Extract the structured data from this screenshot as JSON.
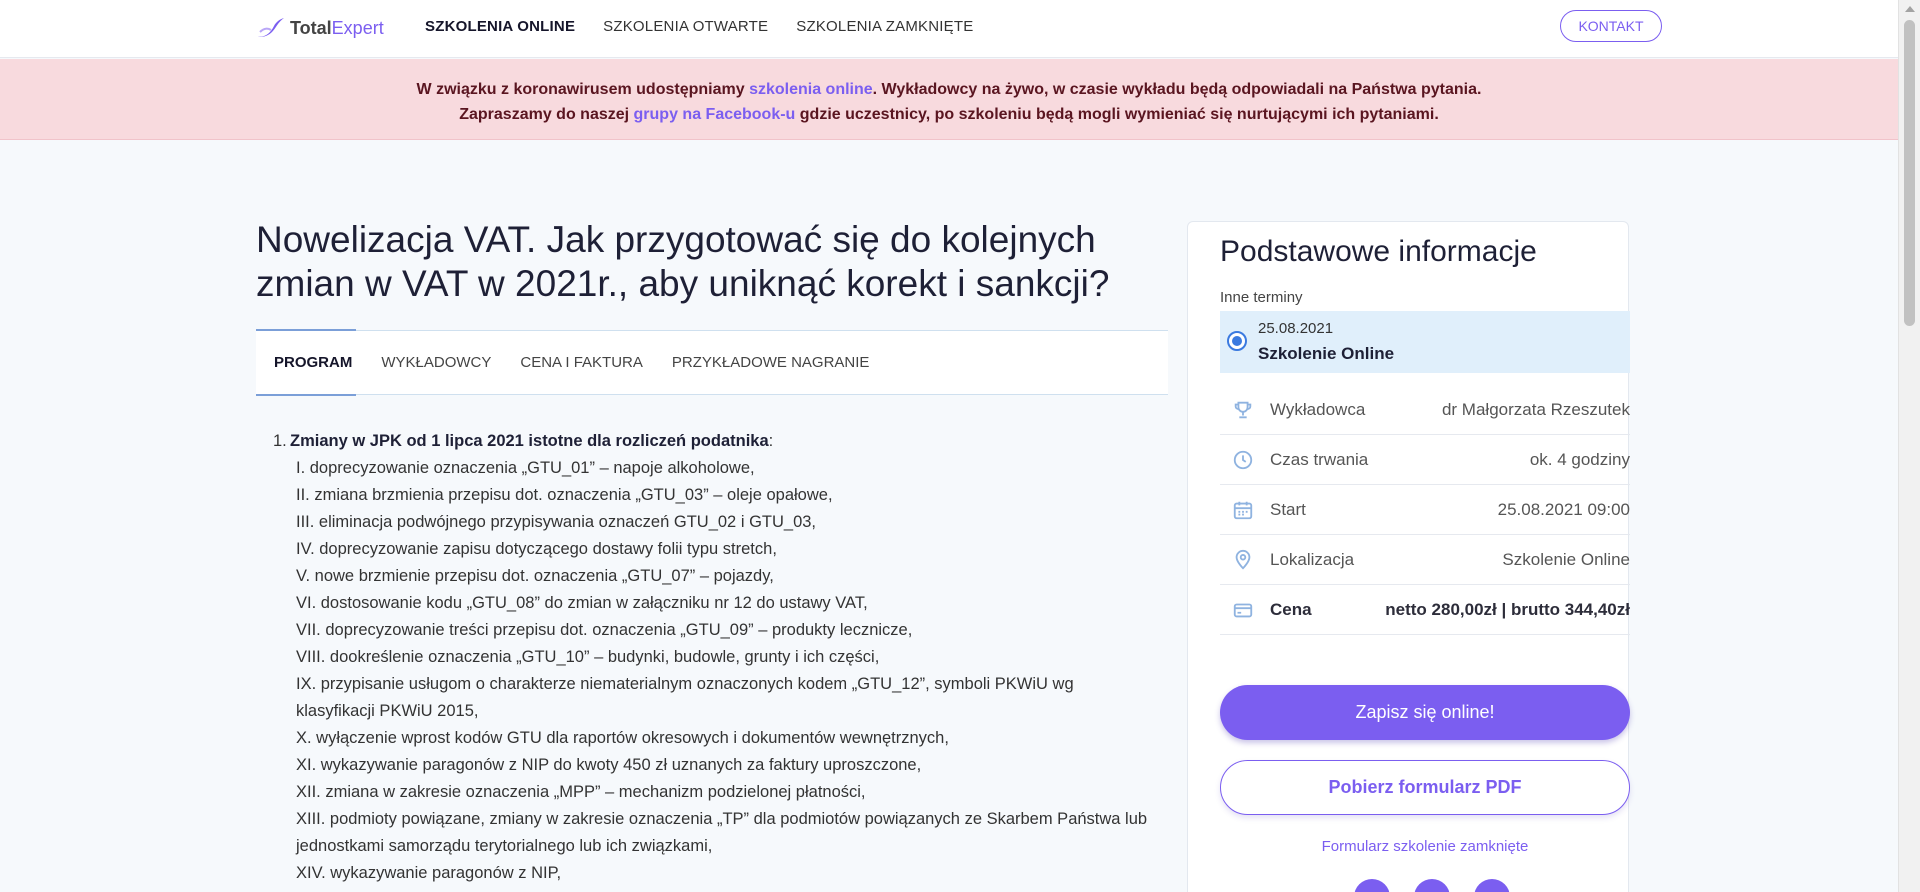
{
  "nav": {
    "logo_a": "Total",
    "logo_b": "Expert",
    "links": [
      "SZKOLENIA ONLINE",
      "SZKOLENIA OTWARTE",
      "SZKOLENIA ZAMKNIĘTE"
    ],
    "contact": "KONTAKT"
  },
  "alert": {
    "l1a": "W związku z koronawirusem udostępniamy ",
    "l1link": "szkolenia online",
    "l1b": ". Wykładowcy na żywo, w czasie wykładu będą odpowiadali na Państwa pytania.",
    "l2a": "Zapraszamy do naszej ",
    "l2link": "grupy na Facebook-u",
    "l2b": " gdzie uczestnicy, po szkoleniu będą mogli wymieniać się nurtującymi ich pytaniami."
  },
  "page_title": "Nowelizacja VAT. Jak przygotować się do kolejnych zmian w VAT w 2021r., aby uniknąć korekt i sankcji?",
  "tabs": [
    "PROGRAM",
    "WYKŁADOWCY",
    "CENA I FAKTURA",
    "PRZYKŁADOWE NAGRANIE"
  ],
  "program": {
    "num": "1.",
    "heading": "Zmiany w JPK od 1 lipca 2021 istotne dla rozliczeń podatnika",
    "heading_suffix": ":",
    "items": [
      "I. doprecyzowanie oznaczenia „GTU_01” – napoje alkoholowe,",
      "II. zmiana brzmienia przepisu dot. oznaczenia „GTU_03” – oleje opałowe,",
      "III. eliminacja podwójnego przypisywania oznaczeń GTU_02 i GTU_03,",
      "IV. doprecyzowanie zapisu dotyczącego dostawy folii typu stretch,",
      "V. nowe brzmienie przepisu dot. oznaczenia „GTU_07” – pojazdy,",
      "VI. dostosowanie kodu „GTU_08” do zmian w załączniku nr 12 do ustawy VAT,",
      "VII. doprecyzowanie treści przepisu dot. oznaczenia „GTU_09” – produkty lecznicze,",
      "VIII. dookreślenie oznaczenia „GTU_10” – budynki, budowle, grunty i ich części,",
      "IX. przypisanie usługom o charakterze niematerialnym oznaczonych kodem „GTU_12”, symboli PKWiU wg klasyfikacji PKWiU 2015,",
      "X. wyłączenie wprost kodów GTU dla raportów okresowych i dokumentów wewnętrznych,",
      "XI. wykazywanie paragonów z NIP do kwoty 450 zł uznanych za faktury uproszczone,",
      "XII. zmiana w zakresie oznaczenia „MPP” – mechanizm podzielonej płatności,",
      "XIII. podmioty powiązane, zmiany w zakresie oznaczenia „TP” dla podmiotów powiązanych ze Skarbem Państwa lub jednostkami samorządu terytorialnego lub ich związkami,",
      "XIV. wykazywanie paragonów z NIP,"
    ]
  },
  "sidebar": {
    "title": "Podstawowe informacje",
    "terms_label": "Inne terminy",
    "term_date": "25.08.2021",
    "term_type": "Szkolenie Online",
    "rows": [
      {
        "label": "Wykładowca",
        "value": "dr Małgorzata Rzeszutek",
        "icon": "trophy-icon"
      },
      {
        "label": "Czas trwania",
        "value": "ok. 4 godziny",
        "icon": "clock-icon"
      },
      {
        "label": "Start",
        "value": "25.08.2021 09:00",
        "icon": "calendar-icon"
      },
      {
        "label": "Lokalizacja",
        "value": "Szkolenie Online",
        "icon": "location-icon"
      },
      {
        "label": "Cena",
        "value": "netto 280,00zł | brutto 344,40zł",
        "icon": "credit-card-icon"
      }
    ],
    "signup": "Zapisz się online!",
    "pdf": "Pobierz formularz PDF",
    "closed": "Formularz szkolenie zamknięte"
  },
  "colors": {
    "accent": "#7b5ef0",
    "alert_bg": "#f8dade",
    "term_bg": "#e0effb",
    "icon": "#8fb3e0"
  }
}
